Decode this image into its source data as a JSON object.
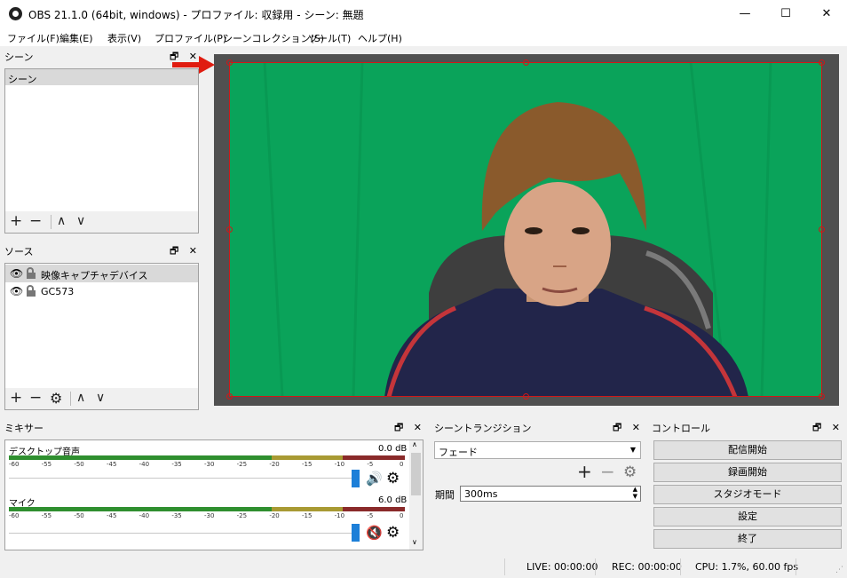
{
  "window": {
    "title": "OBS 21.1.0 (64bit, windows) - プロファイル: 収録用 - シーン: 無題",
    "minimize": "—",
    "maximize": "☐",
    "close": "✕"
  },
  "menu": [
    "ファイル(F)",
    "編集(E)",
    "表示(V)",
    "プロファイル(P)",
    "シーンコレクション(S)",
    "ツール(T)",
    "ヘルプ(H)"
  ],
  "scenes": {
    "title": "シーン",
    "items": [
      "シーン"
    ]
  },
  "sources": {
    "title": "ソース",
    "items": [
      "映像キャプチャデバイス",
      "GC573"
    ]
  },
  "mixer": {
    "title": "ミキサー",
    "ticks": [
      "-60",
      "-55",
      "-50",
      "-45",
      "-40",
      "-35",
      "-30",
      "-25",
      "-20",
      "-15",
      "-10",
      "-5",
      "0"
    ],
    "channels": [
      {
        "name": "デスクトップ音声",
        "db": "0.0 dB",
        "muted": false
      },
      {
        "name": "マイク",
        "db": "6.0 dB",
        "muted": true
      }
    ]
  },
  "transitions": {
    "title": "シーントランジション",
    "selected": "フェード",
    "duration_label": "期間",
    "duration_value": "300ms"
  },
  "controls": {
    "title": "コントロール",
    "buttons": [
      "配信開始",
      "録画開始",
      "スタジオモード",
      "設定",
      "終了"
    ]
  },
  "status": {
    "live": "LIVE: 00:00:00",
    "rec": "REC: 00:00:00",
    "cpu": "CPU: 1.7%, 60.00 fps"
  },
  "dock_buttons": "🗗 ✕",
  "colors": {
    "green_screen": "#0aa35a",
    "selection": "#d01818",
    "preview_bg": "#505050",
    "volume_handle": "#1d7fd8",
    "mute_red": "#d01818"
  }
}
